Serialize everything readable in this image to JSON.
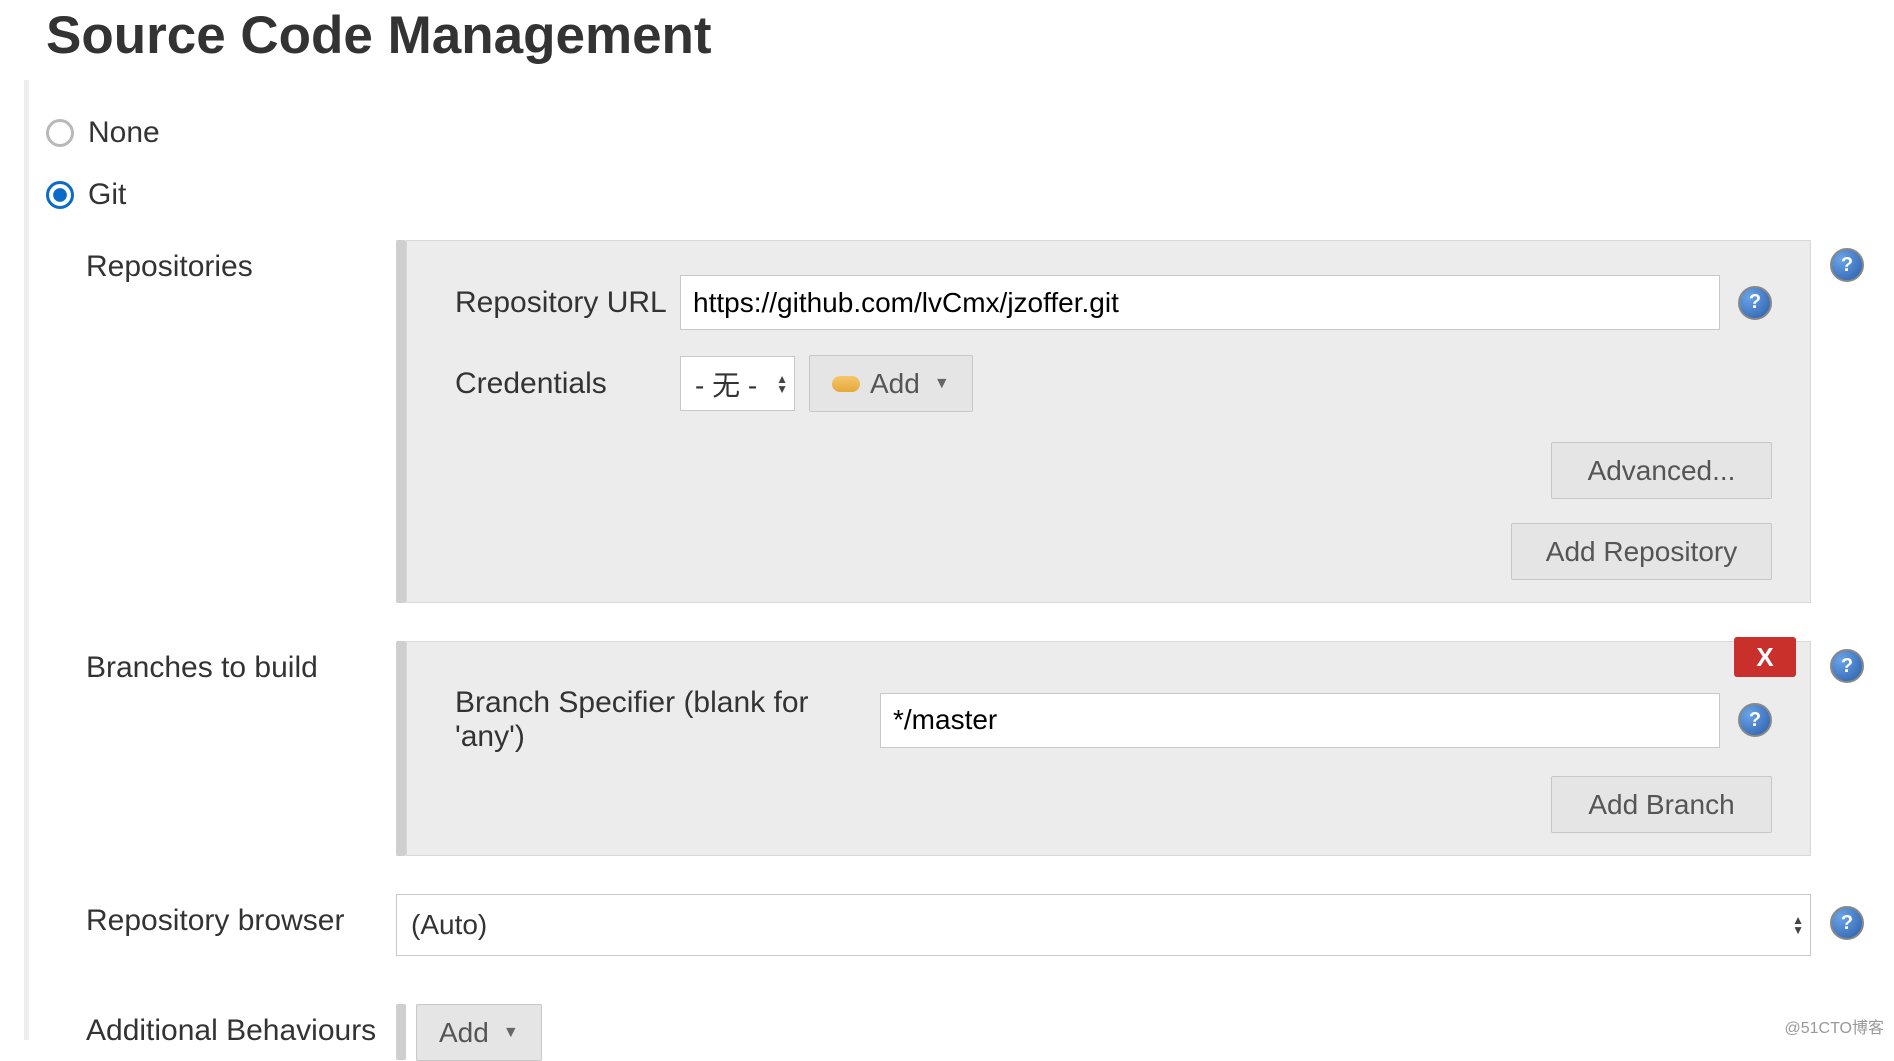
{
  "section_title": "Source Code Management",
  "scm": {
    "none_label": "None",
    "git_label": "Git",
    "selected": "git"
  },
  "repositories": {
    "label": "Repositories",
    "repo_url_label": "Repository URL",
    "repo_url_value": "https://github.com/lvCmx/jzoffer.git",
    "credentials_label": "Credentials",
    "credentials_selected": "- 无 -",
    "add_credentials_label": "Add",
    "advanced_label": "Advanced...",
    "add_repository_label": "Add Repository"
  },
  "branches": {
    "label": "Branches to build",
    "specifier_label": "Branch Specifier (blank for 'any')",
    "specifier_value": "*/master",
    "delete_label": "X",
    "add_branch_label": "Add Branch"
  },
  "browser": {
    "label": "Repository browser",
    "selected": "(Auto)"
  },
  "behaviours": {
    "label": "Additional Behaviours",
    "add_label": "Add"
  },
  "help_glyph": "?",
  "watermark": "@51CTO博客"
}
